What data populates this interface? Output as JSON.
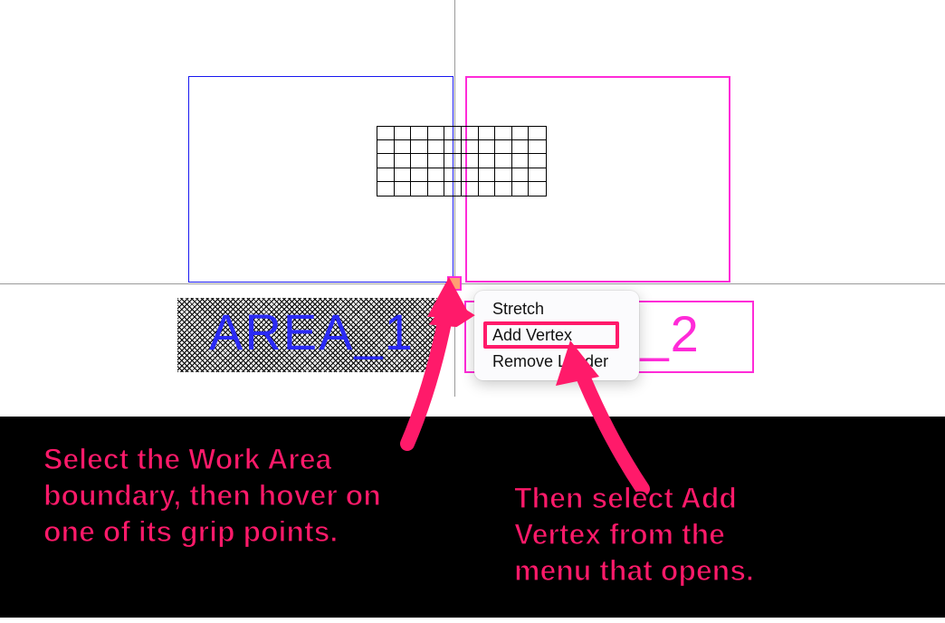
{
  "areas": {
    "area1": {
      "label": "AREA_1"
    },
    "area2": {
      "label": "AREA_2"
    }
  },
  "context_menu": {
    "items": [
      "Stretch",
      "Add Vertex",
      "Remove Leader"
    ],
    "highlighted_index": 1
  },
  "annotations": {
    "left": "Select the Work Area\nboundary, then hover on\none of its grip points.",
    "right": "Then select Add\nVertex from the\nmenu that opens."
  },
  "colors": {
    "accent_pink": "#ff1a6a",
    "area1_blue": "#2a2af5",
    "area2_magenta": "#ff2bd8",
    "grip_fill": "#ff9e73"
  }
}
